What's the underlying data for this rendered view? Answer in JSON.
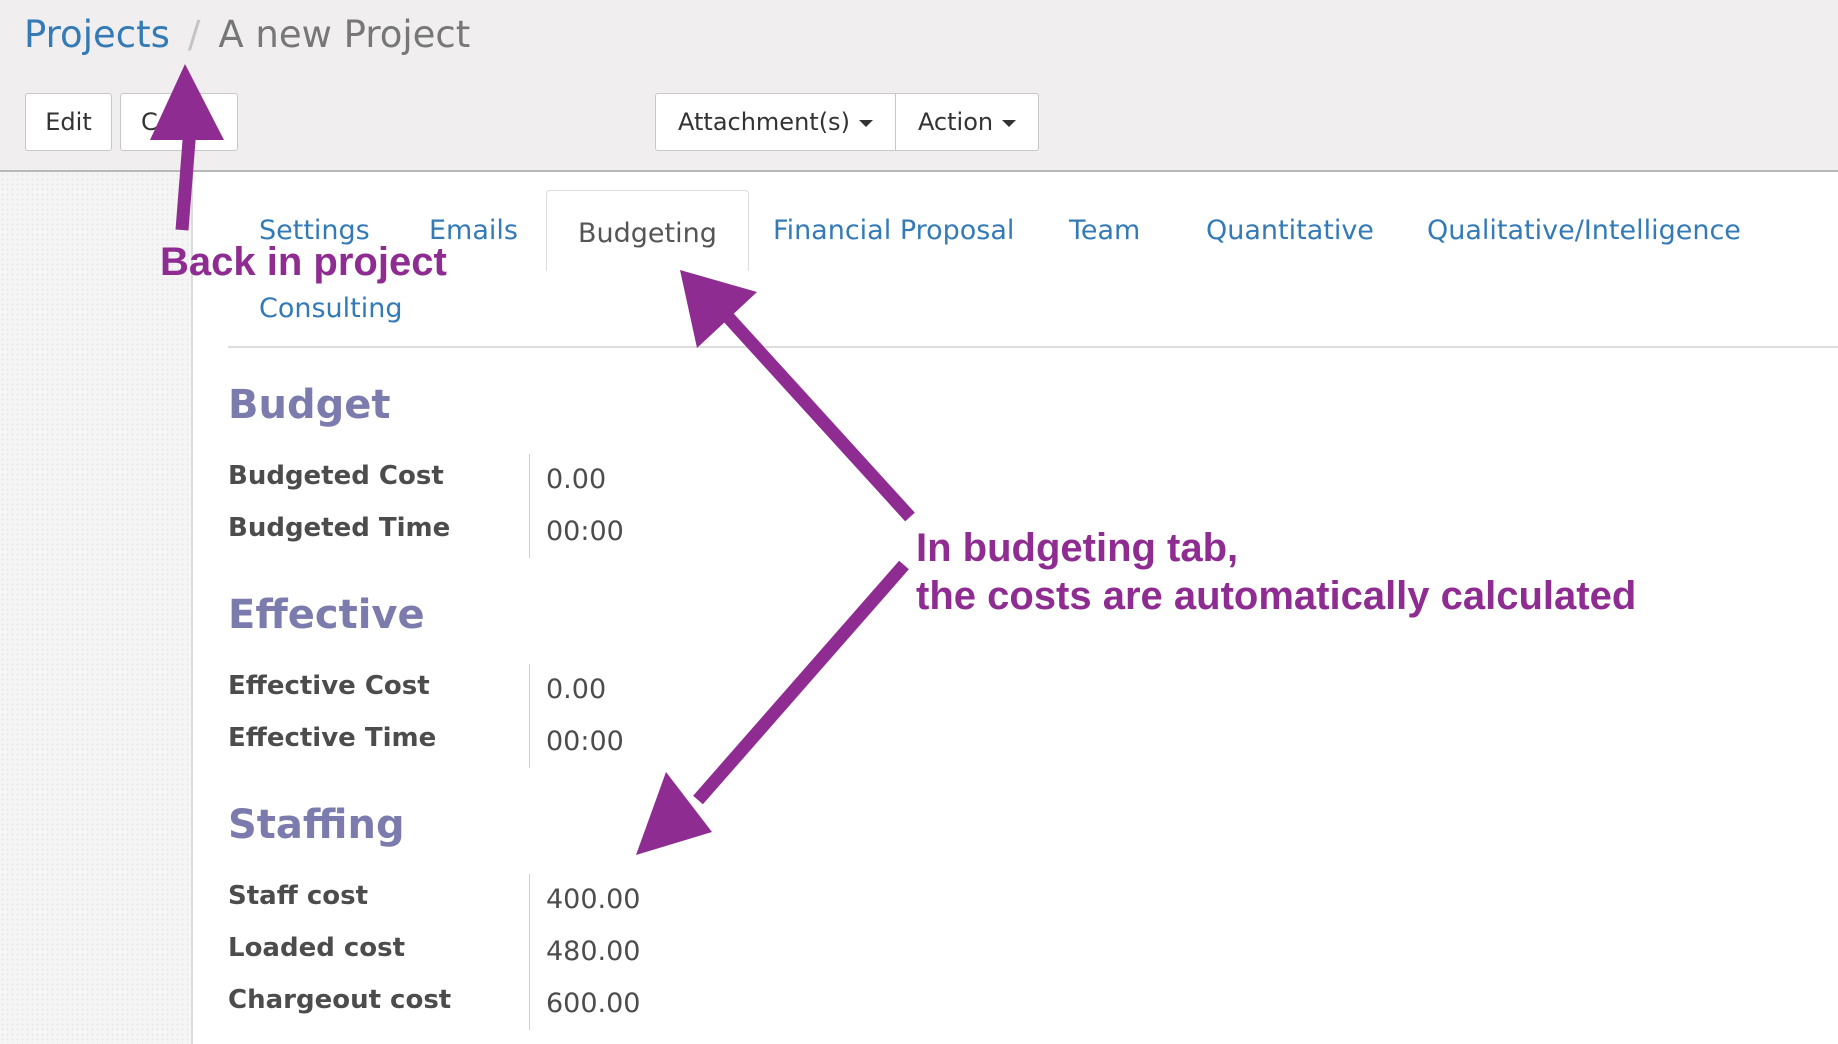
{
  "breadcrumb": {
    "parent": "Projects",
    "separator": "/",
    "current": "A new Project"
  },
  "toolbar": {
    "edit_label": "Edit",
    "create_label_visible": "C",
    "attachments_label": "Attachment(s)",
    "action_label": "Action"
  },
  "tabs": [
    {
      "label": "Settings",
      "active": false
    },
    {
      "label": "Emails",
      "active": false
    },
    {
      "label": "Budgeting",
      "active": true
    },
    {
      "label": "Financial Proposal",
      "active": false
    },
    {
      "label": "Team",
      "active": false
    },
    {
      "label": "Quantitative",
      "active": false
    },
    {
      "label": "Qualitative/Intelligence",
      "active": false
    },
    {
      "label": "Consulting",
      "active": false
    }
  ],
  "sections": {
    "budget": {
      "title": "Budget",
      "fields": [
        {
          "label": "Budgeted Cost",
          "value": "0.00"
        },
        {
          "label": "Budgeted Time",
          "value": "00:00"
        }
      ]
    },
    "effective": {
      "title": "Effective",
      "fields": [
        {
          "label": "Effective Cost",
          "value": "0.00"
        },
        {
          "label": "Effective Time",
          "value": "00:00"
        }
      ]
    },
    "staffing": {
      "title": "Staffing",
      "fields": [
        {
          "label": "Staff cost",
          "value": "400.00"
        },
        {
          "label": "Loaded cost",
          "value": "480.00"
        },
        {
          "label": "Chargeout cost",
          "value": "600.00"
        }
      ]
    }
  },
  "annotations": {
    "back_in_project": "Back in project",
    "budgeting_line1": "In budgeting tab,",
    "budgeting_line2": "the costs are automatically calculated",
    "color": "#8e2c91"
  },
  "colors": {
    "link": "#337ab7",
    "section_title": "#7c7bad",
    "control_panel_bg": "#f0eeee"
  }
}
